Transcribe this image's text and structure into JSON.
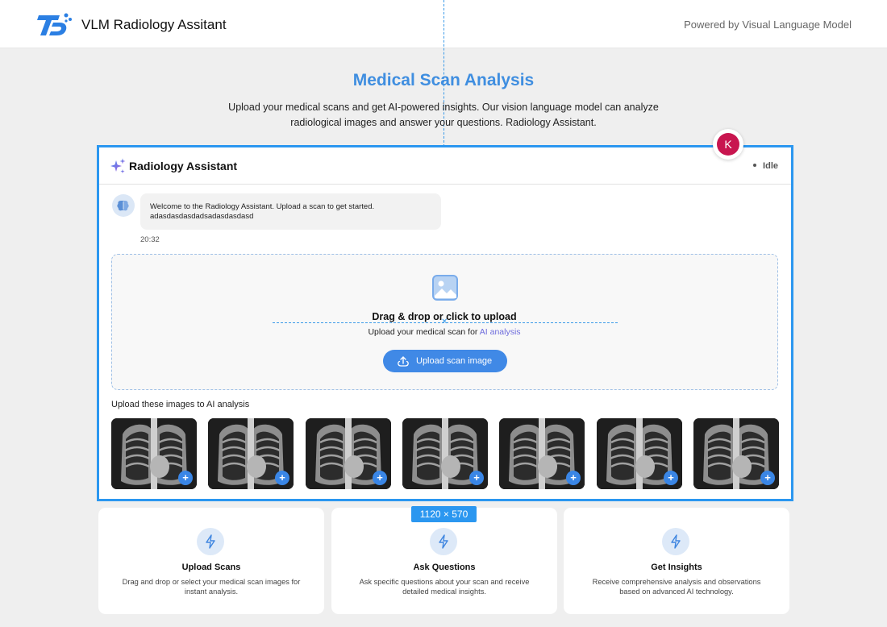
{
  "header": {
    "app_title": "VLM Radiology Assitant",
    "powered_by": "Powered by Visual Language Model"
  },
  "hero": {
    "title": "Medical Scan Analysis",
    "description": "Upload your medical scans and get AI-powered insights. Our vision language model can analyze radiological images and answer your questions. Radiology Assistant."
  },
  "assistant": {
    "title": "Radiology Assistant",
    "status": "Idle",
    "user_initial": "K",
    "messages": [
      {
        "text": "Welcome to the Radiology Assistant. Upload a scan to get started.",
        "extra": "adasdasdasdadsadasdasdasd",
        "time": "20:32"
      }
    ]
  },
  "dropzone": {
    "title": "Drag & drop or click to upload",
    "subtitle_prefix": "Upload your medical scan for ",
    "subtitle_accent": "AI analysis",
    "button_label": "Upload scan image"
  },
  "samples": {
    "caption": "Upload these images to AI analysis",
    "count": 7
  },
  "features": [
    {
      "title": "Upload Scans",
      "description": "Drag and drop or select your medical scan images for instant analysis.",
      "icon": "bolt-icon"
    },
    {
      "title": "Ask Questions",
      "description": "Ask specific questions about your scan and receive detailed medical insights.",
      "icon": "bolt-icon"
    },
    {
      "title": "Get Insights",
      "description": "Receive comprehensive analysis and observations based on advanced AI technology.",
      "icon": "bolt-icon"
    }
  ],
  "overlay": {
    "dimension_label": "1120 × 570"
  },
  "colors": {
    "accent": "#2b97f0",
    "button": "#4089e6",
    "avatar": "#c8154f",
    "link_accent": "#6d6bdc"
  }
}
